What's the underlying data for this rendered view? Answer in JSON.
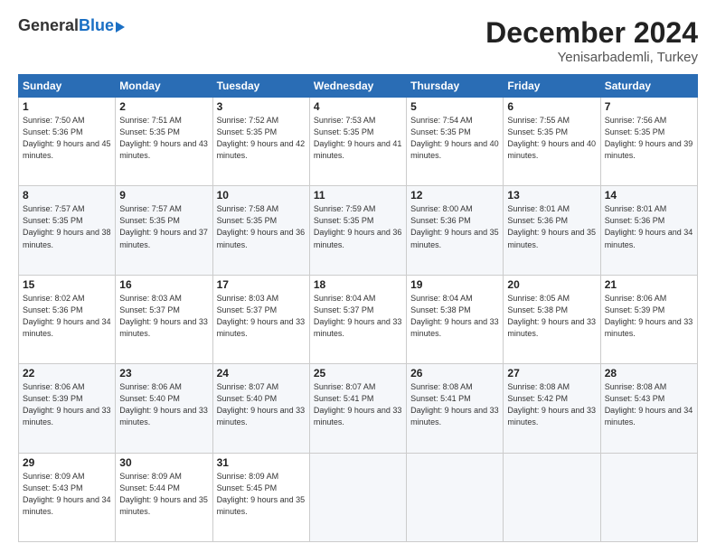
{
  "logo": {
    "general": "General",
    "blue": "Blue"
  },
  "header": {
    "month": "December 2024",
    "location": "Yenisarbademli, Turkey"
  },
  "weekdays": [
    "Sunday",
    "Monday",
    "Tuesday",
    "Wednesday",
    "Thursday",
    "Friday",
    "Saturday"
  ],
  "weeks": [
    [
      {
        "day": "1",
        "sunrise": "Sunrise: 7:50 AM",
        "sunset": "Sunset: 5:36 PM",
        "daylight": "Daylight: 9 hours and 45 minutes."
      },
      {
        "day": "2",
        "sunrise": "Sunrise: 7:51 AM",
        "sunset": "Sunset: 5:35 PM",
        "daylight": "Daylight: 9 hours and 43 minutes."
      },
      {
        "day": "3",
        "sunrise": "Sunrise: 7:52 AM",
        "sunset": "Sunset: 5:35 PM",
        "daylight": "Daylight: 9 hours and 42 minutes."
      },
      {
        "day": "4",
        "sunrise": "Sunrise: 7:53 AM",
        "sunset": "Sunset: 5:35 PM",
        "daylight": "Daylight: 9 hours and 41 minutes."
      },
      {
        "day": "5",
        "sunrise": "Sunrise: 7:54 AM",
        "sunset": "Sunset: 5:35 PM",
        "daylight": "Daylight: 9 hours and 40 minutes."
      },
      {
        "day": "6",
        "sunrise": "Sunrise: 7:55 AM",
        "sunset": "Sunset: 5:35 PM",
        "daylight": "Daylight: 9 hours and 40 minutes."
      },
      {
        "day": "7",
        "sunrise": "Sunrise: 7:56 AM",
        "sunset": "Sunset: 5:35 PM",
        "daylight": "Daylight: 9 hours and 39 minutes."
      }
    ],
    [
      {
        "day": "8",
        "sunrise": "Sunrise: 7:57 AM",
        "sunset": "Sunset: 5:35 PM",
        "daylight": "Daylight: 9 hours and 38 minutes."
      },
      {
        "day": "9",
        "sunrise": "Sunrise: 7:57 AM",
        "sunset": "Sunset: 5:35 PM",
        "daylight": "Daylight: 9 hours and 37 minutes."
      },
      {
        "day": "10",
        "sunrise": "Sunrise: 7:58 AM",
        "sunset": "Sunset: 5:35 PM",
        "daylight": "Daylight: 9 hours and 36 minutes."
      },
      {
        "day": "11",
        "sunrise": "Sunrise: 7:59 AM",
        "sunset": "Sunset: 5:35 PM",
        "daylight": "Daylight: 9 hours and 36 minutes."
      },
      {
        "day": "12",
        "sunrise": "Sunrise: 8:00 AM",
        "sunset": "Sunset: 5:36 PM",
        "daylight": "Daylight: 9 hours and 35 minutes."
      },
      {
        "day": "13",
        "sunrise": "Sunrise: 8:01 AM",
        "sunset": "Sunset: 5:36 PM",
        "daylight": "Daylight: 9 hours and 35 minutes."
      },
      {
        "day": "14",
        "sunrise": "Sunrise: 8:01 AM",
        "sunset": "Sunset: 5:36 PM",
        "daylight": "Daylight: 9 hours and 34 minutes."
      }
    ],
    [
      {
        "day": "15",
        "sunrise": "Sunrise: 8:02 AM",
        "sunset": "Sunset: 5:36 PM",
        "daylight": "Daylight: 9 hours and 34 minutes."
      },
      {
        "day": "16",
        "sunrise": "Sunrise: 8:03 AM",
        "sunset": "Sunset: 5:37 PM",
        "daylight": "Daylight: 9 hours and 33 minutes."
      },
      {
        "day": "17",
        "sunrise": "Sunrise: 8:03 AM",
        "sunset": "Sunset: 5:37 PM",
        "daylight": "Daylight: 9 hours and 33 minutes."
      },
      {
        "day": "18",
        "sunrise": "Sunrise: 8:04 AM",
        "sunset": "Sunset: 5:37 PM",
        "daylight": "Daylight: 9 hours and 33 minutes."
      },
      {
        "day": "19",
        "sunrise": "Sunrise: 8:04 AM",
        "sunset": "Sunset: 5:38 PM",
        "daylight": "Daylight: 9 hours and 33 minutes."
      },
      {
        "day": "20",
        "sunrise": "Sunrise: 8:05 AM",
        "sunset": "Sunset: 5:38 PM",
        "daylight": "Daylight: 9 hours and 33 minutes."
      },
      {
        "day": "21",
        "sunrise": "Sunrise: 8:06 AM",
        "sunset": "Sunset: 5:39 PM",
        "daylight": "Daylight: 9 hours and 33 minutes."
      }
    ],
    [
      {
        "day": "22",
        "sunrise": "Sunrise: 8:06 AM",
        "sunset": "Sunset: 5:39 PM",
        "daylight": "Daylight: 9 hours and 33 minutes."
      },
      {
        "day": "23",
        "sunrise": "Sunrise: 8:06 AM",
        "sunset": "Sunset: 5:40 PM",
        "daylight": "Daylight: 9 hours and 33 minutes."
      },
      {
        "day": "24",
        "sunrise": "Sunrise: 8:07 AM",
        "sunset": "Sunset: 5:40 PM",
        "daylight": "Daylight: 9 hours and 33 minutes."
      },
      {
        "day": "25",
        "sunrise": "Sunrise: 8:07 AM",
        "sunset": "Sunset: 5:41 PM",
        "daylight": "Daylight: 9 hours and 33 minutes."
      },
      {
        "day": "26",
        "sunrise": "Sunrise: 8:08 AM",
        "sunset": "Sunset: 5:41 PM",
        "daylight": "Daylight: 9 hours and 33 minutes."
      },
      {
        "day": "27",
        "sunrise": "Sunrise: 8:08 AM",
        "sunset": "Sunset: 5:42 PM",
        "daylight": "Daylight: 9 hours and 33 minutes."
      },
      {
        "day": "28",
        "sunrise": "Sunrise: 8:08 AM",
        "sunset": "Sunset: 5:43 PM",
        "daylight": "Daylight: 9 hours and 34 minutes."
      }
    ],
    [
      {
        "day": "29",
        "sunrise": "Sunrise: 8:09 AM",
        "sunset": "Sunset: 5:43 PM",
        "daylight": "Daylight: 9 hours and 34 minutes."
      },
      {
        "day": "30",
        "sunrise": "Sunrise: 8:09 AM",
        "sunset": "Sunset: 5:44 PM",
        "daylight": "Daylight: 9 hours and 35 minutes."
      },
      {
        "day": "31",
        "sunrise": "Sunrise: 8:09 AM",
        "sunset": "Sunset: 5:45 PM",
        "daylight": "Daylight: 9 hours and 35 minutes."
      },
      null,
      null,
      null,
      null
    ]
  ]
}
